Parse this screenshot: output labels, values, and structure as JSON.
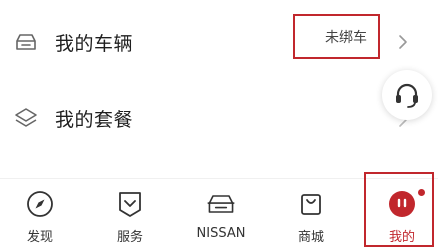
{
  "menu": {
    "vehicles": {
      "label": "我的车辆",
      "status": "未绑车",
      "icon": "car-icon"
    },
    "plans": {
      "label": "我的套餐",
      "icon": "layers-icon"
    }
  },
  "support": {
    "icon": "headset-icon"
  },
  "tabbar": {
    "tabs": [
      {
        "label": "发现",
        "icon": "compass-icon"
      },
      {
        "label": "服务",
        "icon": "shield-icon"
      },
      {
        "label": "NISSAN",
        "icon": "car-front-icon"
      },
      {
        "label": "商城",
        "icon": "shopping-bag-icon"
      },
      {
        "label": "我的",
        "icon": "profile-icon"
      }
    ],
    "active_index": 4
  },
  "colors": {
    "accent": "#c1272d",
    "text": "#1f1f1f",
    "muted": "#444444"
  }
}
